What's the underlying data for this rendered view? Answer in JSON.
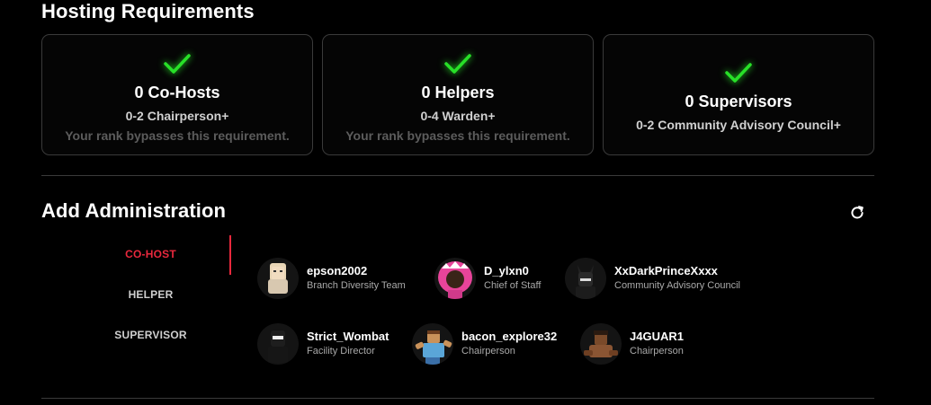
{
  "hosting": {
    "title": "Hosting Requirements",
    "cards": [
      {
        "count": "0 Co-Hosts",
        "rank": "0-2 Chairperson+",
        "bypass": "Your rank bypasses this requirement."
      },
      {
        "count": "0 Helpers",
        "rank": "0-4 Warden+",
        "bypass": "Your rank bypasses this requirement."
      },
      {
        "count": "0 Supervisors",
        "rank": "0-2 Community Advisory Council+"
      }
    ]
  },
  "admin": {
    "title": "Add Administration",
    "tabs": [
      {
        "label": "CO-HOST",
        "active": true
      },
      {
        "label": "HELPER"
      },
      {
        "label": "SUPERVISOR"
      }
    ],
    "users": [
      {
        "name": "epson2002",
        "role": "Branch Diversity Team",
        "avatar": "avatar-icon"
      },
      {
        "name": "D_ylxn0",
        "role": "Chief of Staff",
        "avatar": "avatar-icon"
      },
      {
        "name": "XxDarkPrinceXxxx",
        "role": "Community Advisory Council",
        "avatar": "avatar-icon"
      },
      {
        "name": "Strict_Wombat",
        "role": "Facility Director",
        "avatar": "avatar-icon"
      },
      {
        "name": "bacon_explore32",
        "role": "Chairperson",
        "avatar": "avatar-icon"
      },
      {
        "name": "J4GUAR1",
        "role": "Chairperson",
        "avatar": "avatar-icon"
      }
    ]
  },
  "colors": {
    "accent": "#e8283d",
    "check": "#28e028",
    "background": "#000000",
    "card_border": "#3a3a3a"
  },
  "icons": {
    "check": "check-icon",
    "refresh": "refresh-icon"
  }
}
